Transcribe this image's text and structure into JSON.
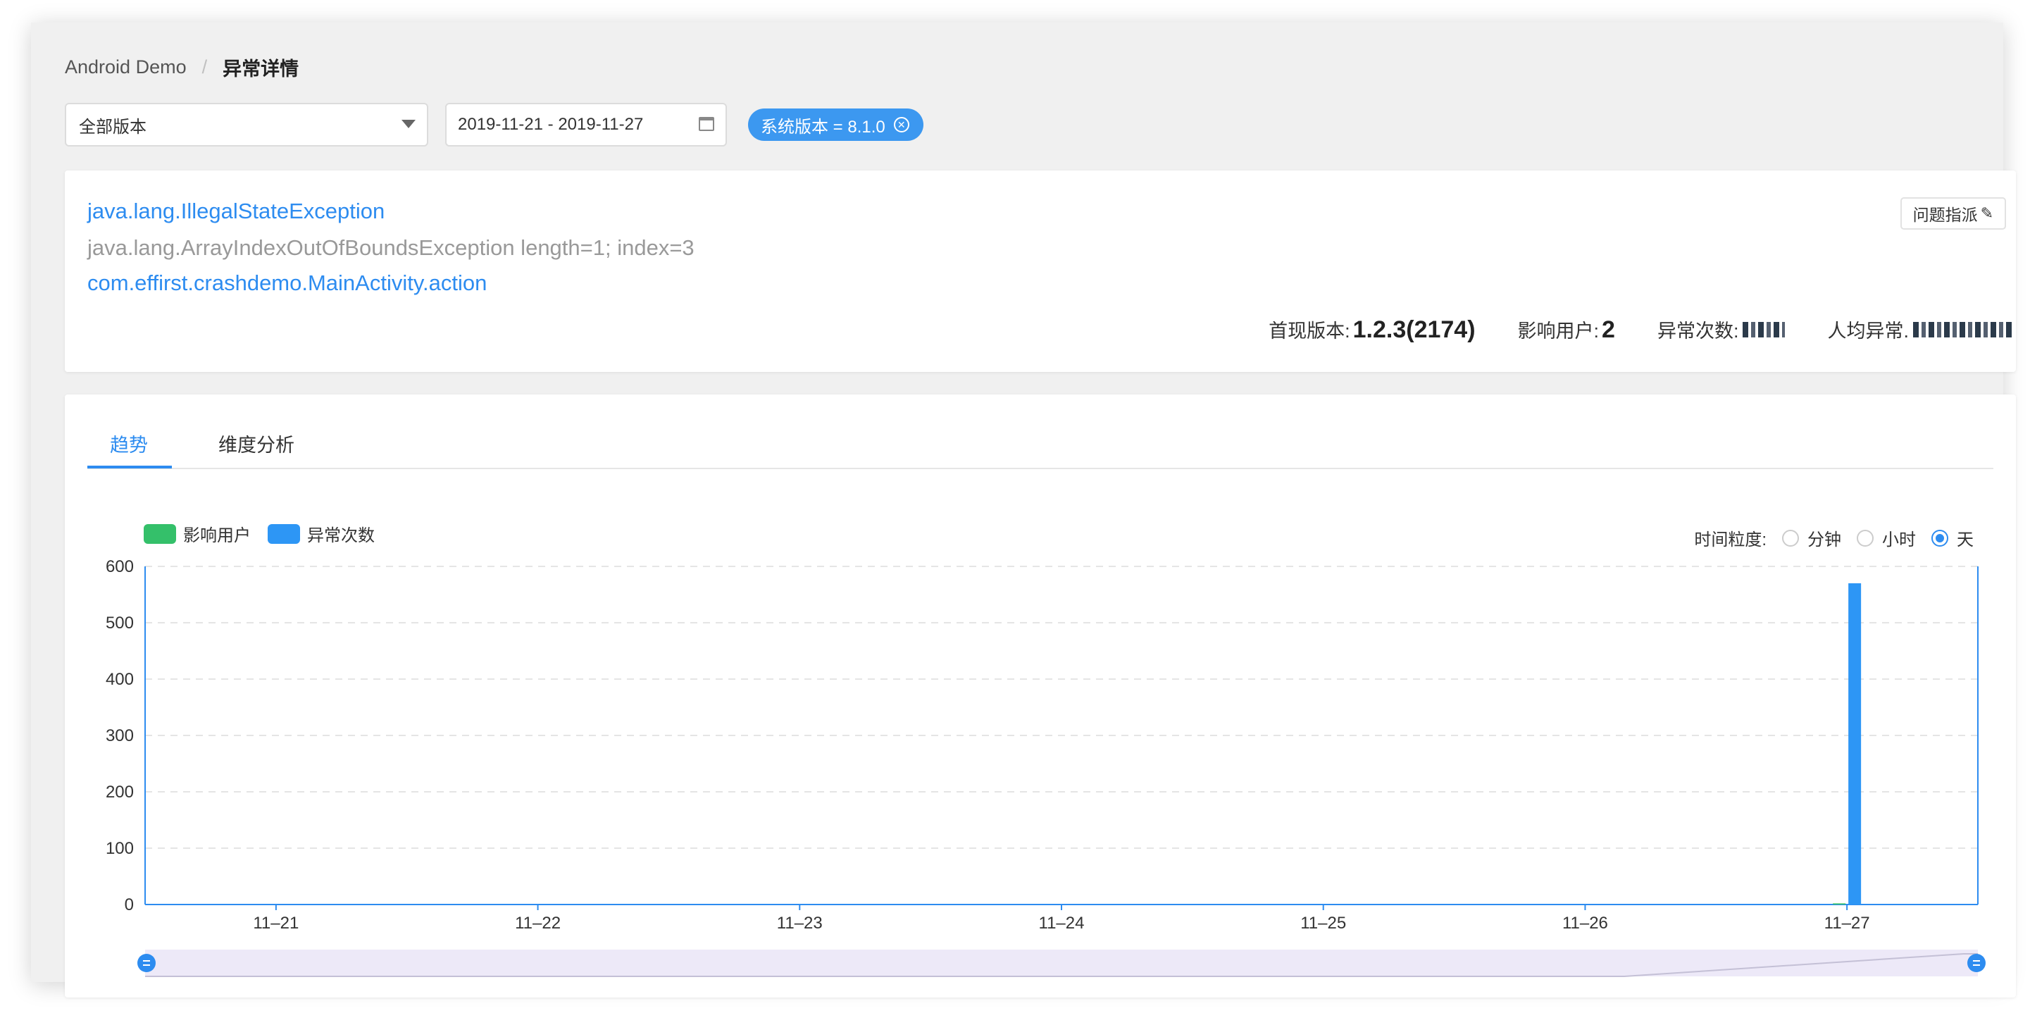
{
  "breadcrumb": {
    "root": "Android Demo",
    "separator": "/",
    "current": "异常详情"
  },
  "filters": {
    "version": "全部版本",
    "date_range": "2019-11-21 - 2019-11-27",
    "tag_label": "系统版本 = 8.1.0",
    "tag_close": "✕"
  },
  "issue": {
    "exception_type": "java.lang.IllegalStateException",
    "exception_message": "java.lang.ArrayIndexOutOfBoundsException length=1; index=3",
    "location": "com.effirst.crashdemo.MainActivity.action",
    "assign_label": "问题指派",
    "stats": {
      "first_version_label": "首现版本:",
      "first_version_value": "1.2.3(2174)",
      "affected_users_label": "影响用户:",
      "affected_users_value": "2",
      "exception_count_label": "异常次数:",
      "per_user_label": "人均异常."
    }
  },
  "tabs": [
    {
      "label": "趋势",
      "active": true
    },
    {
      "label": "维度分析",
      "active": false
    }
  ],
  "granularity": {
    "label": "时间粒度:",
    "options": [
      {
        "label": "分钟",
        "checked": false
      },
      {
        "label": "小时",
        "checked": false
      },
      {
        "label": "天",
        "checked": true
      }
    ]
  },
  "colors": {
    "users": "#34c06a",
    "exceptions": "#2d96f5",
    "accent": "#2d8cf0"
  },
  "chart_data": {
    "type": "bar",
    "categories": [
      "11–21",
      "11–22",
      "11–23",
      "11–24",
      "11–25",
      "11–26",
      "11–27"
    ],
    "series": [
      {
        "name": "影响用户",
        "values": [
          0,
          0,
          0,
          0,
          0,
          0,
          2
        ]
      },
      {
        "name": "异常次数",
        "values": [
          0,
          0,
          0,
          0,
          0,
          0,
          570
        ]
      }
    ],
    "ylim": [
      0,
      600
    ],
    "yticks": [
      "0",
      "100",
      "200",
      "300",
      "400",
      "500",
      "600"
    ],
    "grid": true,
    "legend": "top-left"
  }
}
